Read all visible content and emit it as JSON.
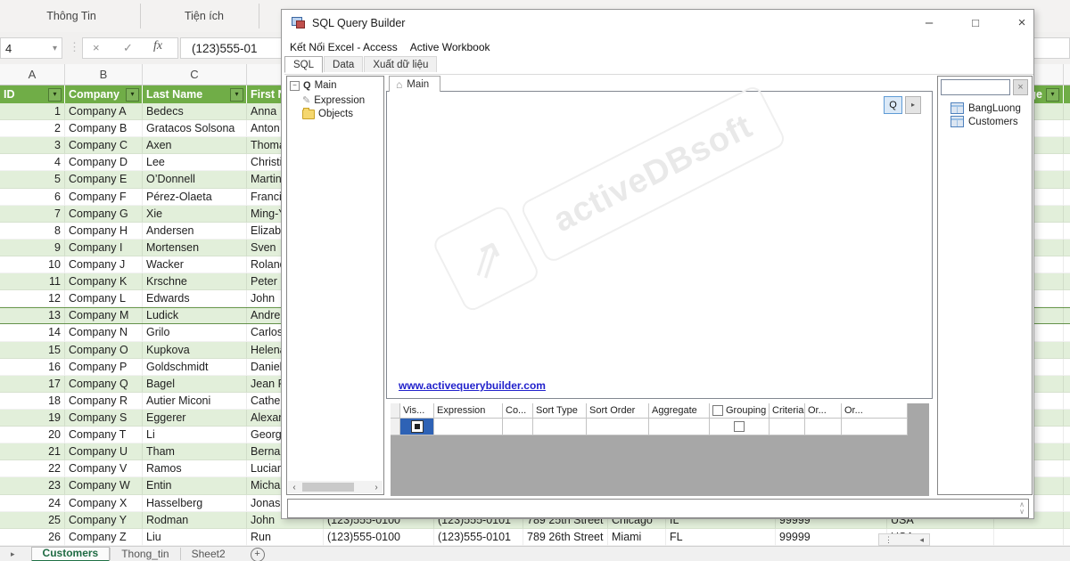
{
  "icons": {
    "dropdown": "▾",
    "collapse": "−",
    "pencil": "✎",
    "house": "⌂",
    "scroll_left": "‹",
    "scroll_right": "›",
    "spin_up": "∧",
    "spin_down": "∨",
    "small_button": "▸",
    "clear": "×",
    "nav_right": "▸",
    "hsplit": "⋮",
    "scroll_left_excel": "◂",
    "cancel": "×",
    "check": "✓",
    "watermark_arrow": "⇗"
  },
  "colors": {
    "header_green": "#70AD47",
    "band_green": "#E2EFDA",
    "active_tab_green": "#217346",
    "selection_blue": "#2E62B5",
    "link_blue": "#2222CC"
  },
  "excel": {
    "ribbon": {
      "labels": [
        "Thông Tin",
        "Tiện ích"
      ]
    },
    "name_box": "4",
    "formula_bar": {
      "fx_label": "fx",
      "value": "(123)555-01"
    },
    "column_letters": [
      "A",
      "B",
      "C"
    ],
    "table": {
      "headers": [
        "ID",
        "Company",
        "Last Name",
        "First Name"
      ],
      "header_fragment": "Web Page",
      "rows": [
        [
          "1",
          "Company A",
          "Bedecs",
          "Anna"
        ],
        [
          "2",
          "Company B",
          "Gratacos Solsona",
          "Anton"
        ],
        [
          "3",
          "Company C",
          "Axen",
          "Thoma"
        ],
        [
          "4",
          "Company D",
          "Lee",
          "Christi"
        ],
        [
          "5",
          "Company E",
          "O’Donnell",
          "Martin"
        ],
        [
          "6",
          "Company F",
          "Pérez-Olaeta",
          "Franci"
        ],
        [
          "7",
          "Company G",
          "Xie",
          "Ming-Y"
        ],
        [
          "8",
          "Company H",
          "Andersen",
          "Elizabe"
        ],
        [
          "9",
          "Company I",
          "Mortensen",
          "Sven"
        ],
        [
          "10",
          "Company J",
          "Wacker",
          "Roland"
        ],
        [
          "11",
          "Company K",
          "Krschne",
          "Peter"
        ],
        [
          "12",
          "Company L",
          "Edwards",
          "John"
        ],
        [
          "13",
          "Company M",
          "Ludick",
          "Andre"
        ],
        [
          "14",
          "Company N",
          "Grilo",
          "Carlos"
        ],
        [
          "15",
          "Company O",
          "Kupkova",
          "Helena"
        ],
        [
          "16",
          "Company P",
          "Goldschmidt",
          "Daniel"
        ],
        [
          "17",
          "Company Q",
          "Bagel",
          "Jean P"
        ],
        [
          "18",
          "Company R",
          "Autier Miconi",
          "Cathe"
        ],
        [
          "19",
          "Company S",
          "Eggerer",
          "Alexan"
        ],
        [
          "20",
          "Company T",
          "Li",
          "Georg"
        ],
        [
          "21",
          "Company U",
          "Tham",
          "Berna"
        ],
        [
          "22",
          "Company V",
          "Ramos",
          "Lucian"
        ],
        [
          "23",
          "Company W",
          "Entin",
          "Micha"
        ],
        [
          "24",
          "Company X",
          "Hasselberg",
          "Jonas"
        ],
        [
          "25",
          "Company Y",
          "Rodman",
          "John",
          "(123)555-0100",
          "(123)555-0101",
          "789 25th Street",
          "Chicago",
          "IL",
          "99999",
          "USA"
        ],
        [
          "26",
          "Company Z",
          "Liu",
          "Run",
          "(123)555-0100",
          "(123)555-0101",
          "789 26th Street",
          "Miami",
          "FL",
          "99999",
          "USA"
        ]
      ]
    },
    "sheet_tabs": {
      "active": "Customers",
      "others": [
        "Thong_tin",
        "Sheet2"
      ],
      "add_label": "+"
    }
  },
  "dialog": {
    "title": "SQL Query Builder",
    "window_buttons": {
      "minimize": "–",
      "maximize": "□",
      "close": "×"
    },
    "menu": [
      "Kết Nối Excel - Access",
      "Active Workbook"
    ],
    "tabs": [
      "SQL",
      "Data",
      "Xuất dữ liệu"
    ],
    "active_tab": "SQL",
    "tree": {
      "root_glyph": "Q",
      "root": "Main",
      "children": [
        "Expression",
        "Objects"
      ]
    },
    "query_area": {
      "tab": "Main",
      "q_button": "Q",
      "watermark": {
        "brand": "activeDBsoft"
      },
      "link": "www.activequerybuilder.com"
    },
    "grid": {
      "columns": [
        "Vis...",
        "Expression",
        "Co...",
        "Sort Type",
        "Sort Order",
        "Aggregate",
        "Grouping",
        "Criteria",
        "Or...",
        "Or..."
      ],
      "checkbox_column_index": 6
    },
    "schema_panel": {
      "search_value": "",
      "items": [
        "BangLuong",
        "Customers"
      ]
    }
  }
}
